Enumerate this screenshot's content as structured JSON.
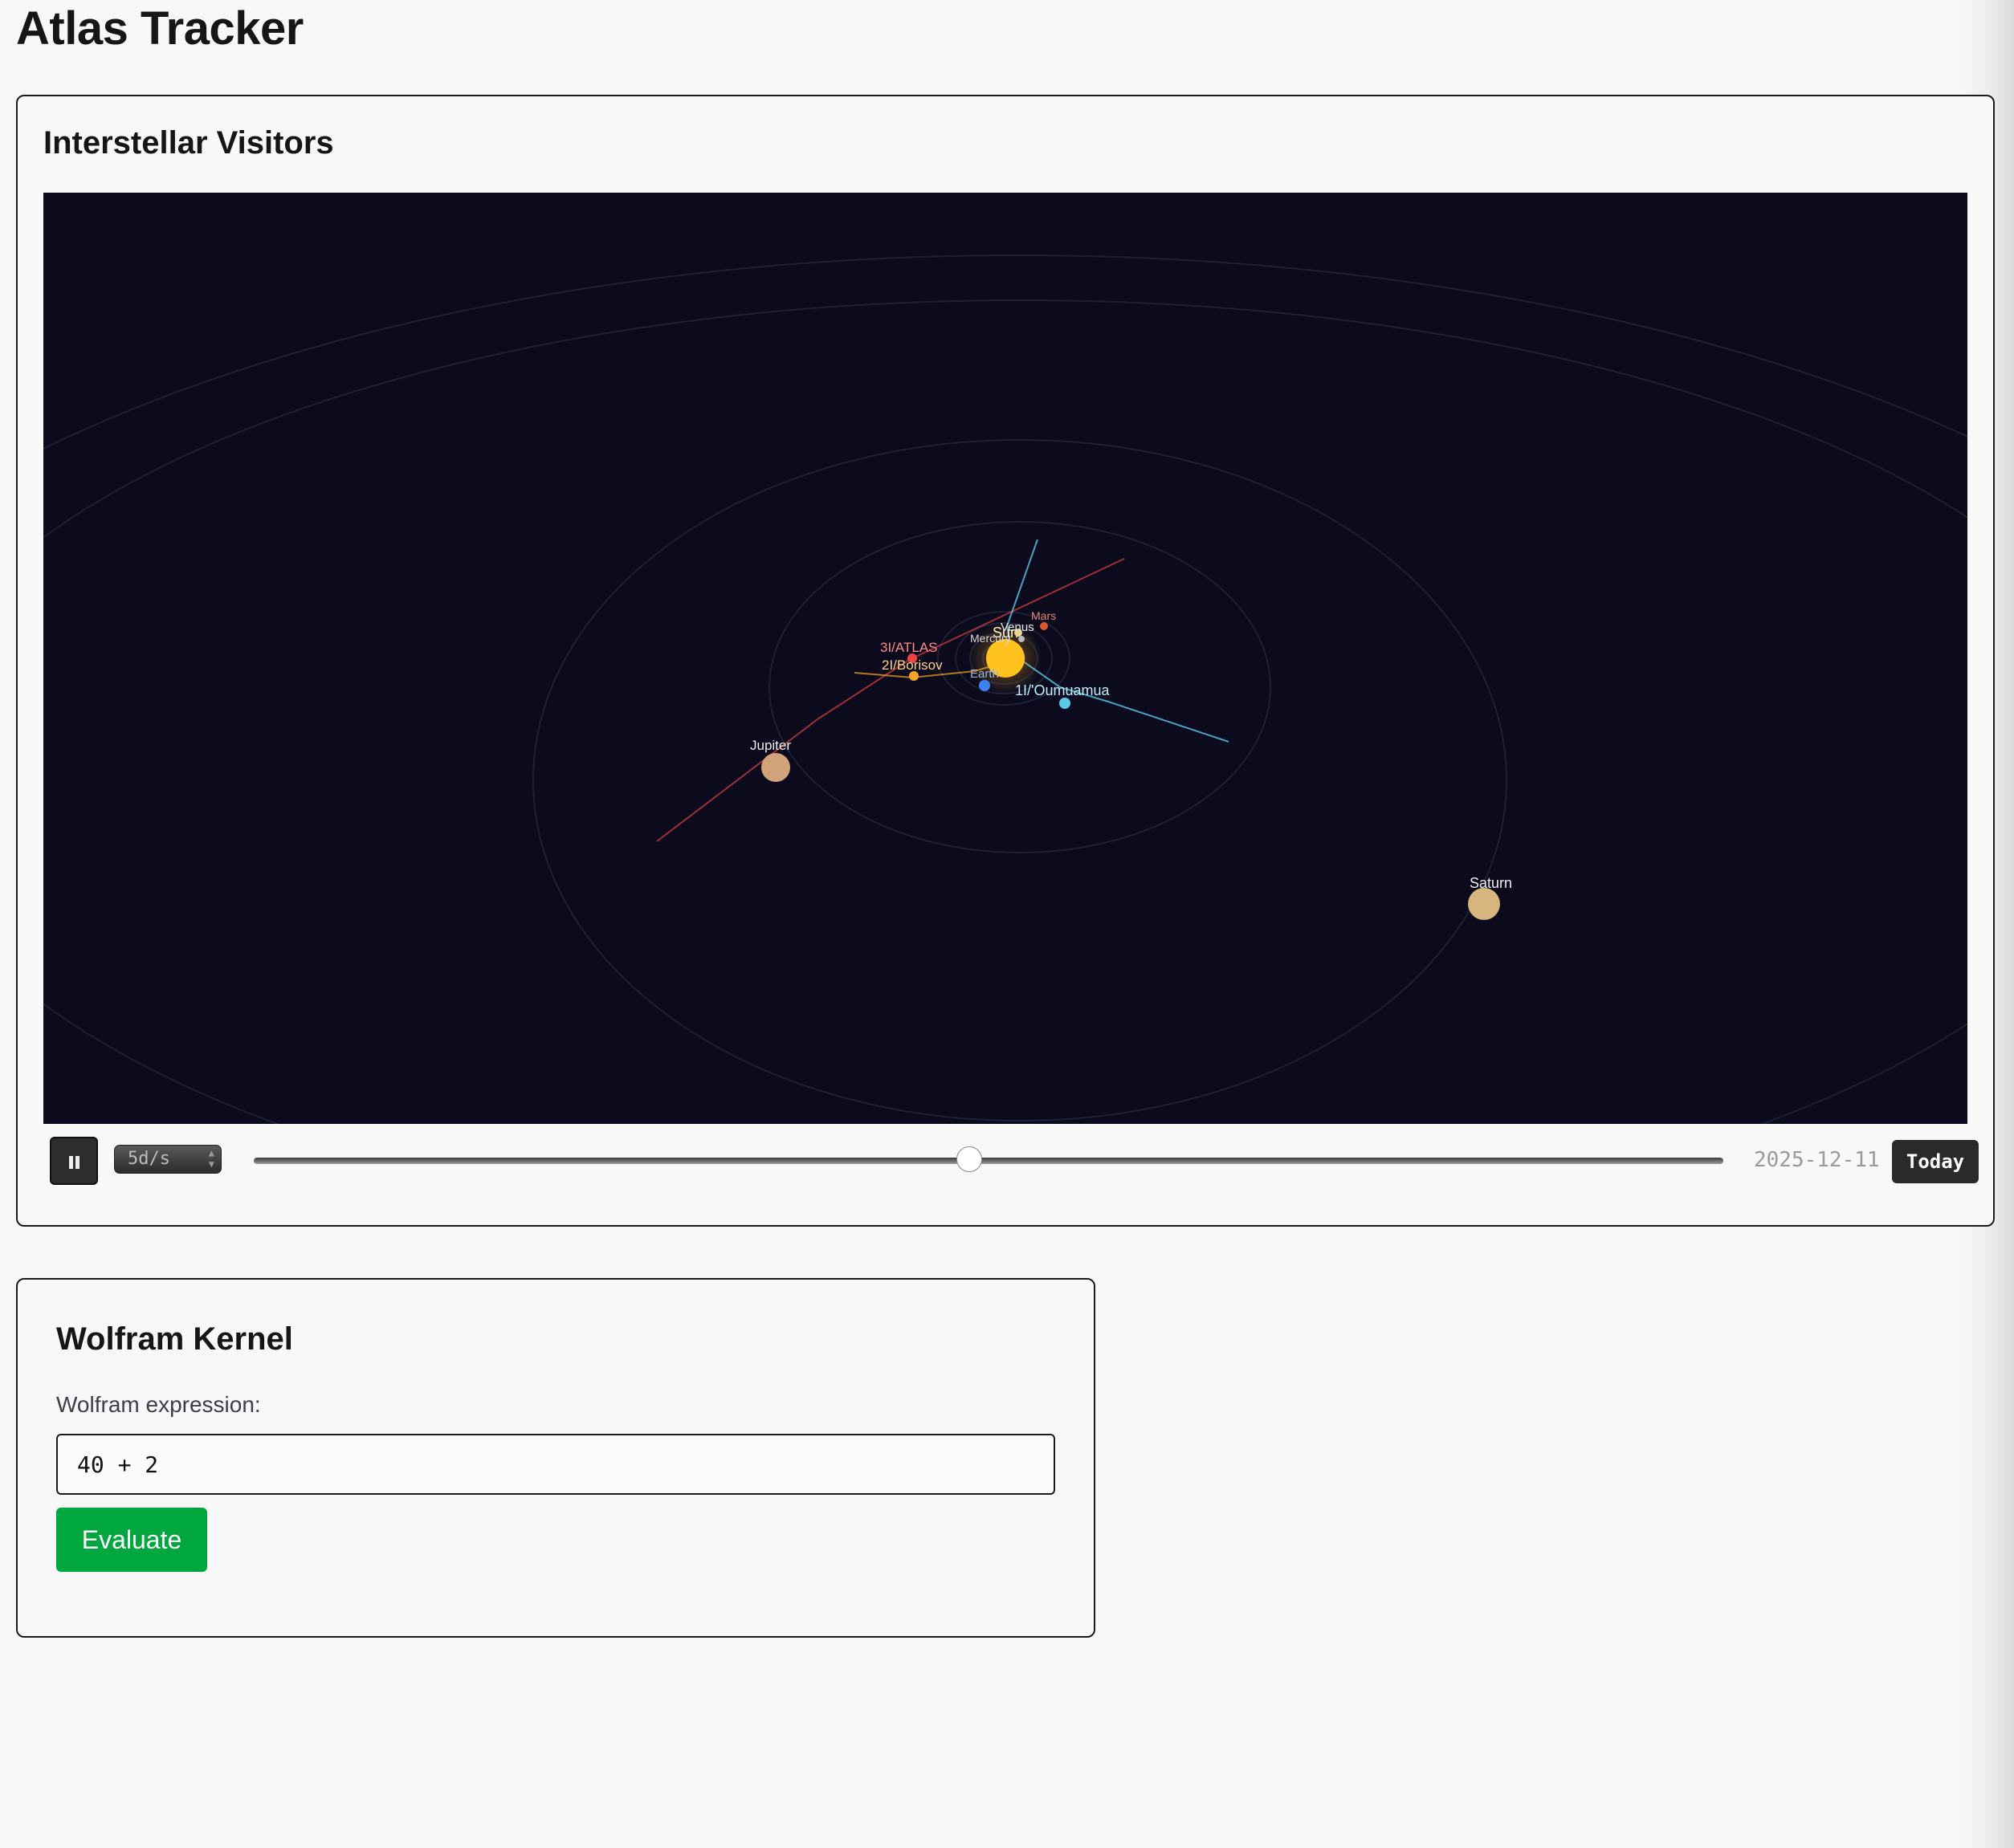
{
  "app": {
    "title": "Atlas Tracker"
  },
  "visitors": {
    "title": "Interstellar Visitors",
    "bodies": [
      {
        "name": "Sun",
        "color": "#ffc21f"
      },
      {
        "name": "Mercury",
        "color": "#b9b9b9"
      },
      {
        "name": "Venus",
        "color": "#e7d29a"
      },
      {
        "name": "Earth",
        "color": "#3b82f6"
      },
      {
        "name": "Mars",
        "color": "#e0552d"
      },
      {
        "name": "Jupiter",
        "color": "#d2a27a"
      },
      {
        "name": "Saturn",
        "color": "#d6b57e"
      }
    ],
    "objects": [
      {
        "name": "3I/ATLAS",
        "color": "#ef4444"
      },
      {
        "name": "2I/Borisov",
        "color": "#f5a524"
      },
      {
        "name": "1I/'Oumuamua",
        "color": "#5bc8ea"
      }
    ],
    "controls": {
      "speed": "5d/s",
      "date": "2025-12-11",
      "today_label": "Today",
      "timeline_position": 0.487
    }
  },
  "kernel": {
    "title": "Wolfram Kernel",
    "expression_label": "Wolfram expression:",
    "expression_value": "40 + 2",
    "evaluate_label": "Evaluate"
  }
}
